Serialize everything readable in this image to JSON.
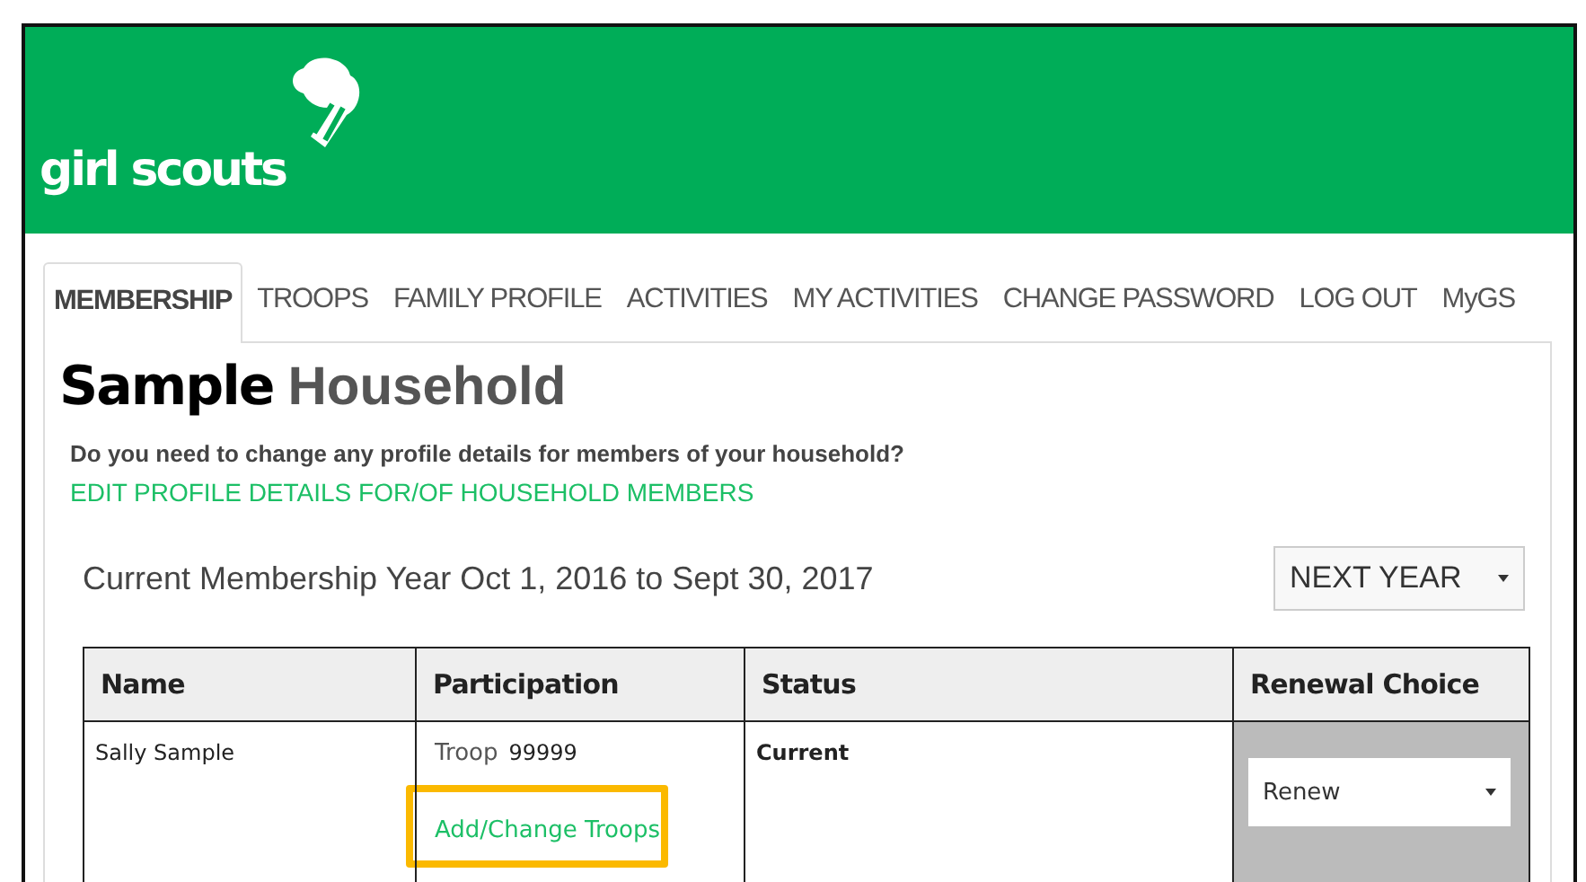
{
  "header": {
    "logo_text": "girl scouts"
  },
  "tabs": [
    {
      "label": "MEMBERSHIP",
      "selected": true
    },
    {
      "label": "TROOPS",
      "selected": false
    },
    {
      "label": "FAMILY PROFILE",
      "selected": false
    },
    {
      "label": "ACTIVITIES",
      "selected": false
    },
    {
      "label": "MY ACTIVITIES",
      "selected": false
    },
    {
      "label": "CHANGE PASSWORD",
      "selected": false
    },
    {
      "label": "LOG OUT",
      "selected": false
    },
    {
      "label": "MyGS",
      "selected": false
    }
  ],
  "household": {
    "title_first": "Sample",
    "title_rest": "Household",
    "question": "Do you need to change any profile details for members of your household?",
    "edit_link": "EDIT PROFILE DETAILS FOR/OF HOUSEHOLD MEMBERS"
  },
  "membership_year": {
    "text": "Current Membership Year Oct 1, 2016 to Sept 30, 2017",
    "year_select": "NEXT YEAR"
  },
  "table": {
    "columns": [
      "Name",
      "Participation",
      "Status",
      "Renewal Choice"
    ],
    "rows": [
      {
        "name": "Sally Sample",
        "troop_label": "Troop",
        "troop_number": "99999",
        "troop_link": "Add/Change Troops",
        "highlighted": true,
        "status": "Current",
        "renewal": "Renew"
      }
    ]
  }
}
